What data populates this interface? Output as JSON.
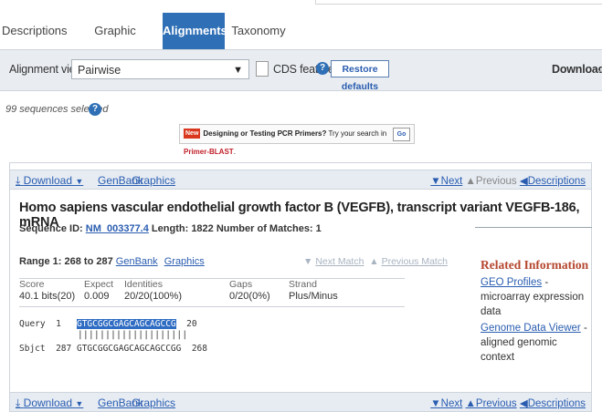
{
  "tabs": [
    {
      "label": "Descriptions"
    },
    {
      "label": "Graphic Summary"
    },
    {
      "label": "Alignments",
      "active": true
    },
    {
      "label": "Taxonomy"
    }
  ],
  "view_bar": {
    "label": "Alignment view",
    "selected": "Pairwise",
    "cds_label": "CDS feature",
    "restore_label": "Restore defaults",
    "download_label": "Download"
  },
  "selection": {
    "text": "99 sequences selected"
  },
  "banner": {
    "new_badge": "New",
    "text": "Designing or Testing PCR Primers?",
    "try_text": "Try your search in",
    "primer_link": "Primer-BLAST",
    "go_label": "Go"
  },
  "hit": {
    "download": "Download",
    "genbank": "GenBank",
    "graphics": "Graphics",
    "next": "Next",
    "previous": "Previous",
    "descriptions": "Descriptions",
    "title": "Homo sapiens vascular endothelial growth factor B (VEGFB), transcript variant VEGFB-186, mRNA",
    "seqid_label": "Sequence ID:",
    "seqid": "NM_003377.4",
    "length_label": "Length:",
    "length": "1822",
    "matches_label": "Number of Matches:",
    "matches": "1",
    "range_label": "Range 1: 268 to 287",
    "next_match": "Next Match",
    "prev_match": "Previous Match",
    "stats": {
      "headers": [
        "Score",
        "Expect",
        "Identities",
        "Gaps",
        "Strand"
      ],
      "values": [
        "40.1 bits(20)",
        "0.009",
        "20/20(100%)",
        "0/20(0%)",
        "Plus/Minus"
      ]
    },
    "query": {
      "label": "Query",
      "start": "1",
      "seq": "GTGCGGCGAGCAGCAGCCG",
      "end": "20"
    },
    "pipes": "||||||||||||||||||||",
    "sbjct": {
      "label": "Sbjct",
      "start": "287",
      "seq": "GTGCGGCGAGCAGCAGCCGG",
      "end": "268"
    }
  },
  "related": {
    "heading": "Related Information",
    "geo_link": "GEO Profiles",
    "geo_text": "- microarray expression data",
    "gdv_link": "Genome Data Viewer",
    "gdv_text": "- aligned genomic context"
  },
  "colors": {
    "tab_active": "#2e6fb6",
    "link": "#2a5db0",
    "related_heading": "#b5472f",
    "highlight": "#2f6cc3"
  }
}
